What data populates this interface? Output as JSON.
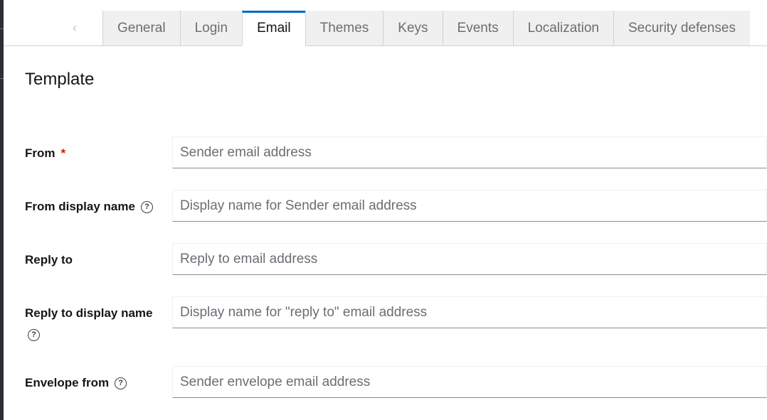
{
  "tabs": [
    "General",
    "Login",
    "Email",
    "Themes",
    "Keys",
    "Events",
    "Localization",
    "Security defenses"
  ],
  "active_tab": "Email",
  "section_title": "Template",
  "fields": {
    "from": {
      "label": "From",
      "required_marker": "*",
      "placeholder": "Sender email address",
      "value": ""
    },
    "from_display_name": {
      "label": "From display name",
      "placeholder": "Display name for Sender email address",
      "value": ""
    },
    "reply_to": {
      "label": "Reply to",
      "placeholder": "Reply to email address",
      "value": ""
    },
    "reply_to_display_name": {
      "label": "Reply to display name",
      "placeholder": "Display name for \"reply to\" email address",
      "value": ""
    },
    "envelope_from": {
      "label": "Envelope from",
      "placeholder": "Sender envelope email address",
      "value": ""
    }
  },
  "icons": {
    "scroll_left": "chevron-left-icon",
    "help": "help-circle-icon"
  },
  "colors": {
    "accent": "#0066cc",
    "required": "#c9190b",
    "text": "#151515",
    "muted": "#6a6e73"
  }
}
